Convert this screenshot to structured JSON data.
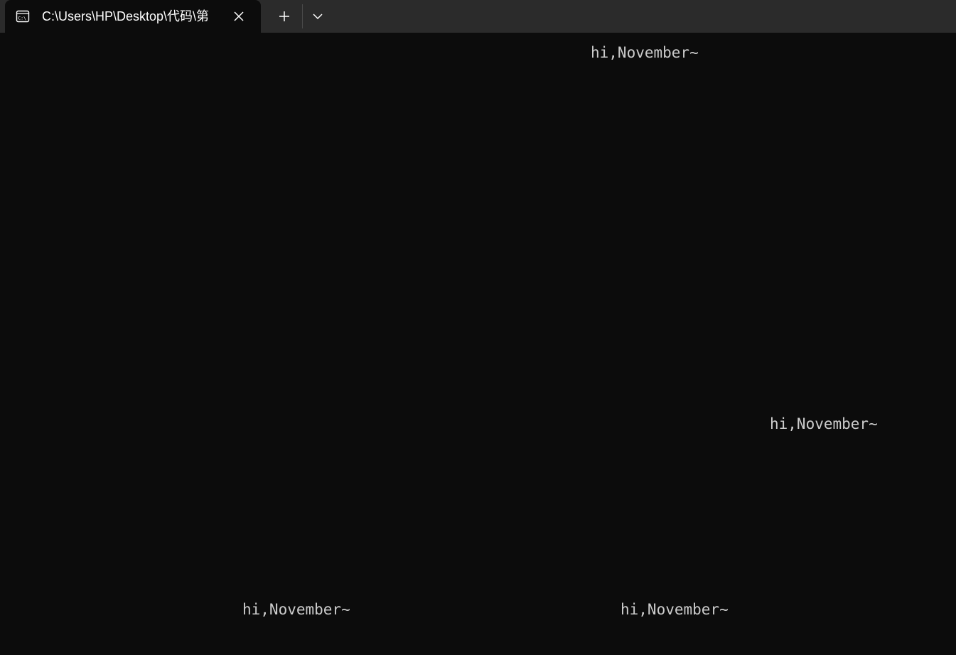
{
  "app": {
    "tab": {
      "title": "C:\\Users\\HP\\Desktop\\代码\\第",
      "icon": "terminal-icon",
      "close_icon": "close-icon"
    },
    "new_tab_icon": "plus-icon",
    "dropdown_icon": "chevron-down-icon"
  },
  "terminal": {
    "lines": [
      "hi,November~",
      "hi,November~",
      "hi,November~",
      "hi,November~"
    ]
  },
  "colors": {
    "background": "#0c0c0c",
    "titlebar": "#2b2b2b",
    "text": "#cccccc"
  }
}
